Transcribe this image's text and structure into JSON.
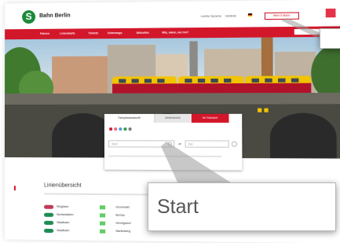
{
  "brand": {
    "name": "Bahn Berlin",
    "logo_letter": "S"
  },
  "util_links": [
    "Leichte Sprache",
    "Gebärde"
  ],
  "login_label": "Mein S-Bahn",
  "topnav": [
    "Fahren",
    "Linienkarte",
    "Tickets",
    "Unterwegs",
    "Aktuelles",
    "Wie, wann, wo hin?"
  ],
  "widget": {
    "tabs": [
      "Fahrplanauskunft",
      "Abfahrtsinfo",
      "Ihr Standort"
    ],
    "from_placeholder": "Start",
    "to_placeholder": "Ziel",
    "swap_glyph": "⇄",
    "dot_colors": [
      "#d3172b",
      "#e06a8a",
      "#4a9bd6",
      "#2a9a4a",
      "#7a7a7a"
    ]
  },
  "section": {
    "title": "Linienübersicht",
    "rows": [
      {
        "label": "Ringbahn",
        "color": "#c23a59"
      },
      {
        "label": "Nordsüdbahn",
        "color": "#1f8b55"
      },
      {
        "label": "Stadtbahn",
        "color": "#1f8b55"
      },
      {
        "label": "Stadtbahn",
        "color": "#1f8b55"
      }
    ],
    "col2": [
      "Grunewald",
      "Bernau",
      "Hennigsdorf",
      "Wartenberg"
    ]
  },
  "callouts": {
    "main": "Start"
  },
  "colors": {
    "brand_red": "#d3172b",
    "brand_green": "#1b8a3a"
  }
}
